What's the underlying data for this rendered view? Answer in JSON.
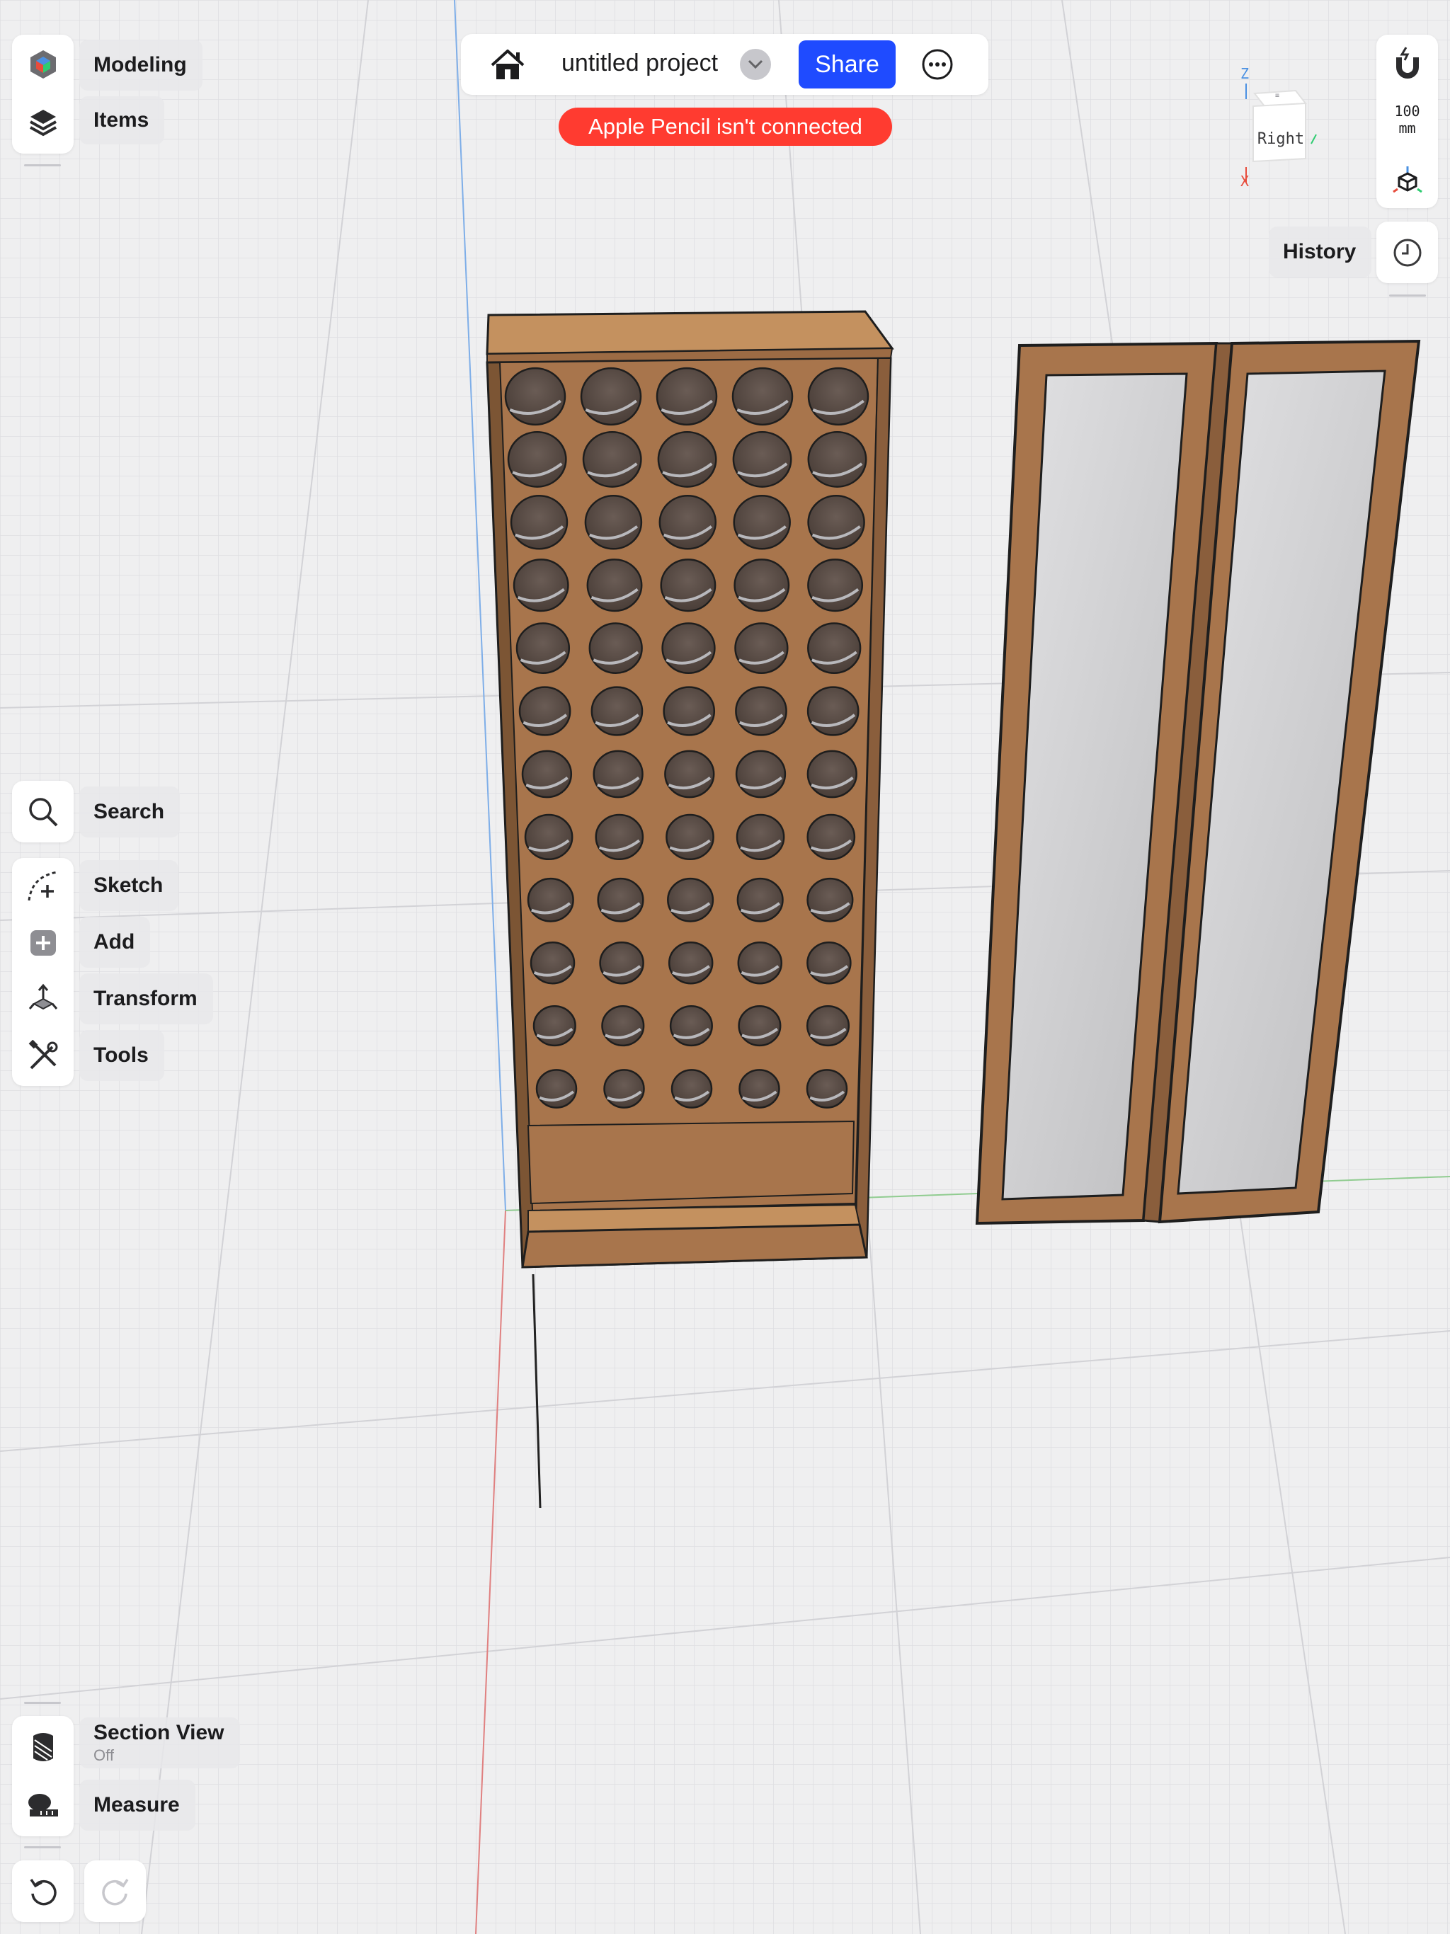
{
  "app": {
    "project_title": "untitled project",
    "share_label": "Share",
    "pencil_warning": "Apple Pencil isn't connected"
  },
  "top_left_panel": {
    "items": [
      {
        "label": "Modeling",
        "icon": "modeling-cube-icon"
      },
      {
        "label": "Items",
        "icon": "layers-icon"
      }
    ]
  },
  "tools_panel": {
    "search": {
      "label": "Search",
      "icon": "search-icon"
    },
    "items": [
      {
        "label": "Sketch",
        "icon": "sketch-icon"
      },
      {
        "label": "Add",
        "icon": "add-icon"
      },
      {
        "label": "Transform",
        "icon": "transform-icon"
      },
      {
        "label": "Tools",
        "icon": "tools-icon"
      }
    ]
  },
  "bottom_panel": {
    "section_view": {
      "label": "Section View",
      "status": "Off",
      "icon": "section-view-icon"
    },
    "measure": {
      "label": "Measure",
      "icon": "tape-measure-icon"
    },
    "undo_icon": "undo-icon",
    "redo_icon": "redo-icon"
  },
  "right_panel": {
    "grid_size_value": "100",
    "grid_size_unit": "mm",
    "history_label": "History",
    "snap_icon": "magnet-icon",
    "view_icon": "cube-view-icon",
    "history_icon": "clock-icon"
  },
  "view_cube": {
    "face_label": "Right",
    "axis_z": "Z",
    "axis_x": "X"
  },
  "colors": {
    "accent": "#1f4bff",
    "warning": "#ff3b30",
    "wood": "#a8754c",
    "glass": "#c9c9cb"
  }
}
